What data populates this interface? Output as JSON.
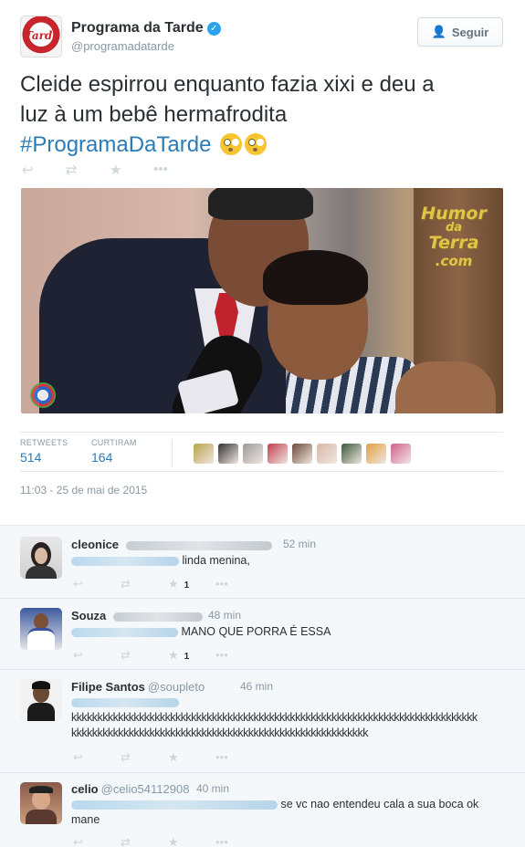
{
  "account": {
    "name": "Programa da Tarde",
    "handle": "@programadatarde",
    "avatar_text": "Tarde"
  },
  "follow_button": {
    "label": "Seguir"
  },
  "tweet": {
    "text_line1": "Cleide espirrou enquanto fazia xixi e deu a",
    "text_line2": "luz à um bebê hermafrodita",
    "hashtag": "#ProgramaDaTarde",
    "emoji_name": "flushed-face-emoji"
  },
  "tweet_actions": [
    {
      "name": "reply-icon",
      "glyph": "↩"
    },
    {
      "name": "retweet-icon",
      "glyph": "⇄"
    },
    {
      "name": "favorite-icon",
      "glyph": "★"
    },
    {
      "name": "more-icon",
      "glyph": "•••"
    }
  ],
  "watermark": {
    "line1": "Humor",
    "line2": "da",
    "line3": "Terra",
    "line4": ".com"
  },
  "stats": {
    "retweets_label": "RETWEETS",
    "retweets_value": "514",
    "favorites_label": "CURTIRAM",
    "favorites_value": "164"
  },
  "favorer_colors": [
    "#b8a24a",
    "#333333",
    "#9a9a9a",
    "#c04050",
    "#6a4a3a",
    "#d8b8a8",
    "#3a5a3a",
    "#e0a040",
    "#d06090"
  ],
  "timestamp": "11:03 - 25 de mai de 2015",
  "replies": [
    {
      "name": "cleonice",
      "handle": "",
      "time": "52 min",
      "text": "linda menina,",
      "text2": "",
      "fav_count": "1"
    },
    {
      "name": "Souza",
      "handle": "",
      "time": "48 min",
      "text": "MANO QUE PORRA É ESSA",
      "text2": "",
      "fav_count": "1"
    },
    {
      "name": "Filipe Santos",
      "handle": "@soupleto",
      "time": "46 min",
      "text": "kkkkkkkkkkkkkkkkkkkkkkkkkkkkkkkkkkkkkkkkkkkkkkkkkkkkkkkkkkkkkkkkkkkkkkkkkkkkkk",
      "text2": "kkkkkkkkkkkkkkkkkkkkkkkkkkkkkkkkkkkkkkkkkkkkkkkkkkkkkkkkk",
      "fav_count": ""
    },
    {
      "name": "celio",
      "handle": "@celio54112908",
      "time": "40 min",
      "text": "se vc nao entendeu cala a sua boca ok",
      "text2": "mane",
      "fav_count": ""
    }
  ]
}
